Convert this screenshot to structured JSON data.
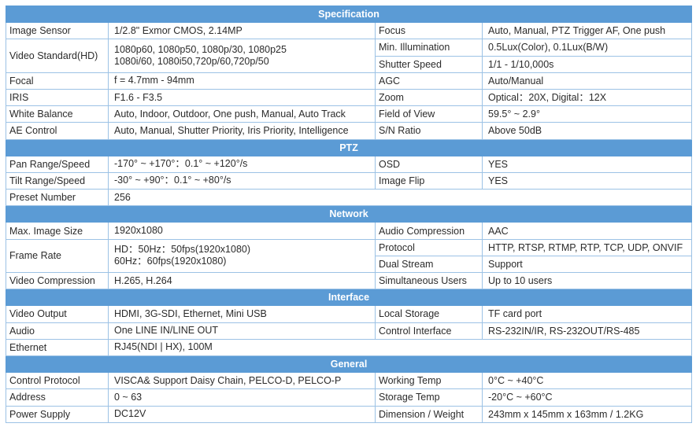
{
  "colors": {
    "header_bg": "#5b9bd5",
    "border": "#9cc2e5",
    "header_text": "#ffffff"
  },
  "sections": [
    {
      "title": "Specification",
      "left": [
        {
          "label": "Image Sensor",
          "value": [
            "1/2.8\" Exmor CMOS, 2.14MP"
          ]
        },
        {
          "label": "Video Standard(HD)",
          "value": [
            "1080p60, 1080p50, 1080p/30, 1080p25",
            "1080i/60, 1080i50,720p/60,720p/50"
          ]
        },
        {
          "label": "Focal",
          "value": [
            "f = 4.7mm - 94mm"
          ]
        },
        {
          "label": "IRIS",
          "value": [
            "F1.6 - F3.5"
          ]
        },
        {
          "label": "White Balance",
          "value": [
            "Auto, Indoor, Outdoor, One push, Manual, Auto Track"
          ]
        },
        {
          "label": "AE Control",
          "value": [
            "Auto, Manual, Shutter Priority, Iris Priority, Intelligence"
          ]
        }
      ],
      "right": [
        {
          "label": "Focus",
          "value": "Auto, Manual, PTZ Trigger AF, One push"
        },
        {
          "label": "Min. Illumination",
          "value": "0.5Lux(Color), 0.1Lux(B/W)"
        },
        {
          "label": "Shutter Speed",
          "value": "1/1 - 1/10,000s"
        },
        {
          "label": "AGC",
          "value": "Auto/Manual"
        },
        {
          "label": "Zoom",
          "value": "Optical：20X, Digital：12X"
        },
        {
          "label": "Field of View",
          "value": "59.5° ~ 2.9°"
        },
        {
          "label": "S/N Ratio",
          "value": "Above 50dB"
        }
      ]
    },
    {
      "title": "PTZ",
      "left": [
        {
          "label": "Pan Range/Speed",
          "value": [
            "-170° ~ +170°：0.1° ~ +120°/s"
          ]
        },
        {
          "label": "Tilt Range/Speed",
          "value": [
            "-30° ~ +90°：0.1° ~ +80°/s"
          ]
        },
        {
          "label": "Preset Number",
          "value": [
            "256"
          ]
        }
      ],
      "right": [
        {
          "label": "OSD",
          "value": "YES"
        },
        {
          "label": "Image Flip",
          "value": "YES"
        }
      ]
    },
    {
      "title": "Network",
      "left": [
        {
          "label": "Max. Image Size",
          "value": [
            "1920x1080"
          ]
        },
        {
          "label": "Frame Rate",
          "value": [
            "HD：50Hz：50fps(1920x1080)",
            "60Hz：60fps(1920x1080)"
          ]
        },
        {
          "label": "Video Compression",
          "value": [
            "H.265, H.264"
          ]
        }
      ],
      "right": [
        {
          "label": "Audio Compression",
          "value": "AAC"
        },
        {
          "label": "Protocol",
          "value": "HTTP, RTSP, RTMP, RTP, TCP, UDP, ONVIF"
        },
        {
          "label": "Dual Stream",
          "value": "Support"
        },
        {
          "label": "Simultaneous Users",
          "value": "Up to 10 users"
        }
      ]
    },
    {
      "title": "Interface",
      "left": [
        {
          "label": "Video Output",
          "value": [
            "HDMI, 3G-SDI, Ethernet, Mini USB"
          ]
        },
        {
          "label": "Audio",
          "value": [
            "One LINE IN/LINE OUT"
          ]
        },
        {
          "label": "Ethernet",
          "value": [
            "RJ45(NDI | HX), 100M"
          ]
        }
      ],
      "right": [
        {
          "label": "Local Storage",
          "value": "TF card port"
        },
        {
          "label": "Control Interface",
          "value": "RS-232IN/IR, RS-232OUT/RS-485"
        }
      ]
    },
    {
      "title": "General",
      "left": [
        {
          "label": "Control Protocol",
          "value": [
            "VISCA& Support Daisy Chain, PELCO-D, PELCO-P"
          ]
        },
        {
          "label": "Address",
          "value": [
            "0 ~ 63"
          ]
        },
        {
          "label": "Power Supply",
          "value": [
            "DC12V"
          ]
        }
      ],
      "right": [
        {
          "label": "Working Temp",
          "value": " 0°C ~ +40°C"
        },
        {
          "label": "Storage Temp",
          "value": "-20°C ~ +60°C"
        },
        {
          "label": "Dimension / Weight",
          "value": "243mm x 145mm x 163mm / 1.2KG"
        }
      ]
    }
  ]
}
